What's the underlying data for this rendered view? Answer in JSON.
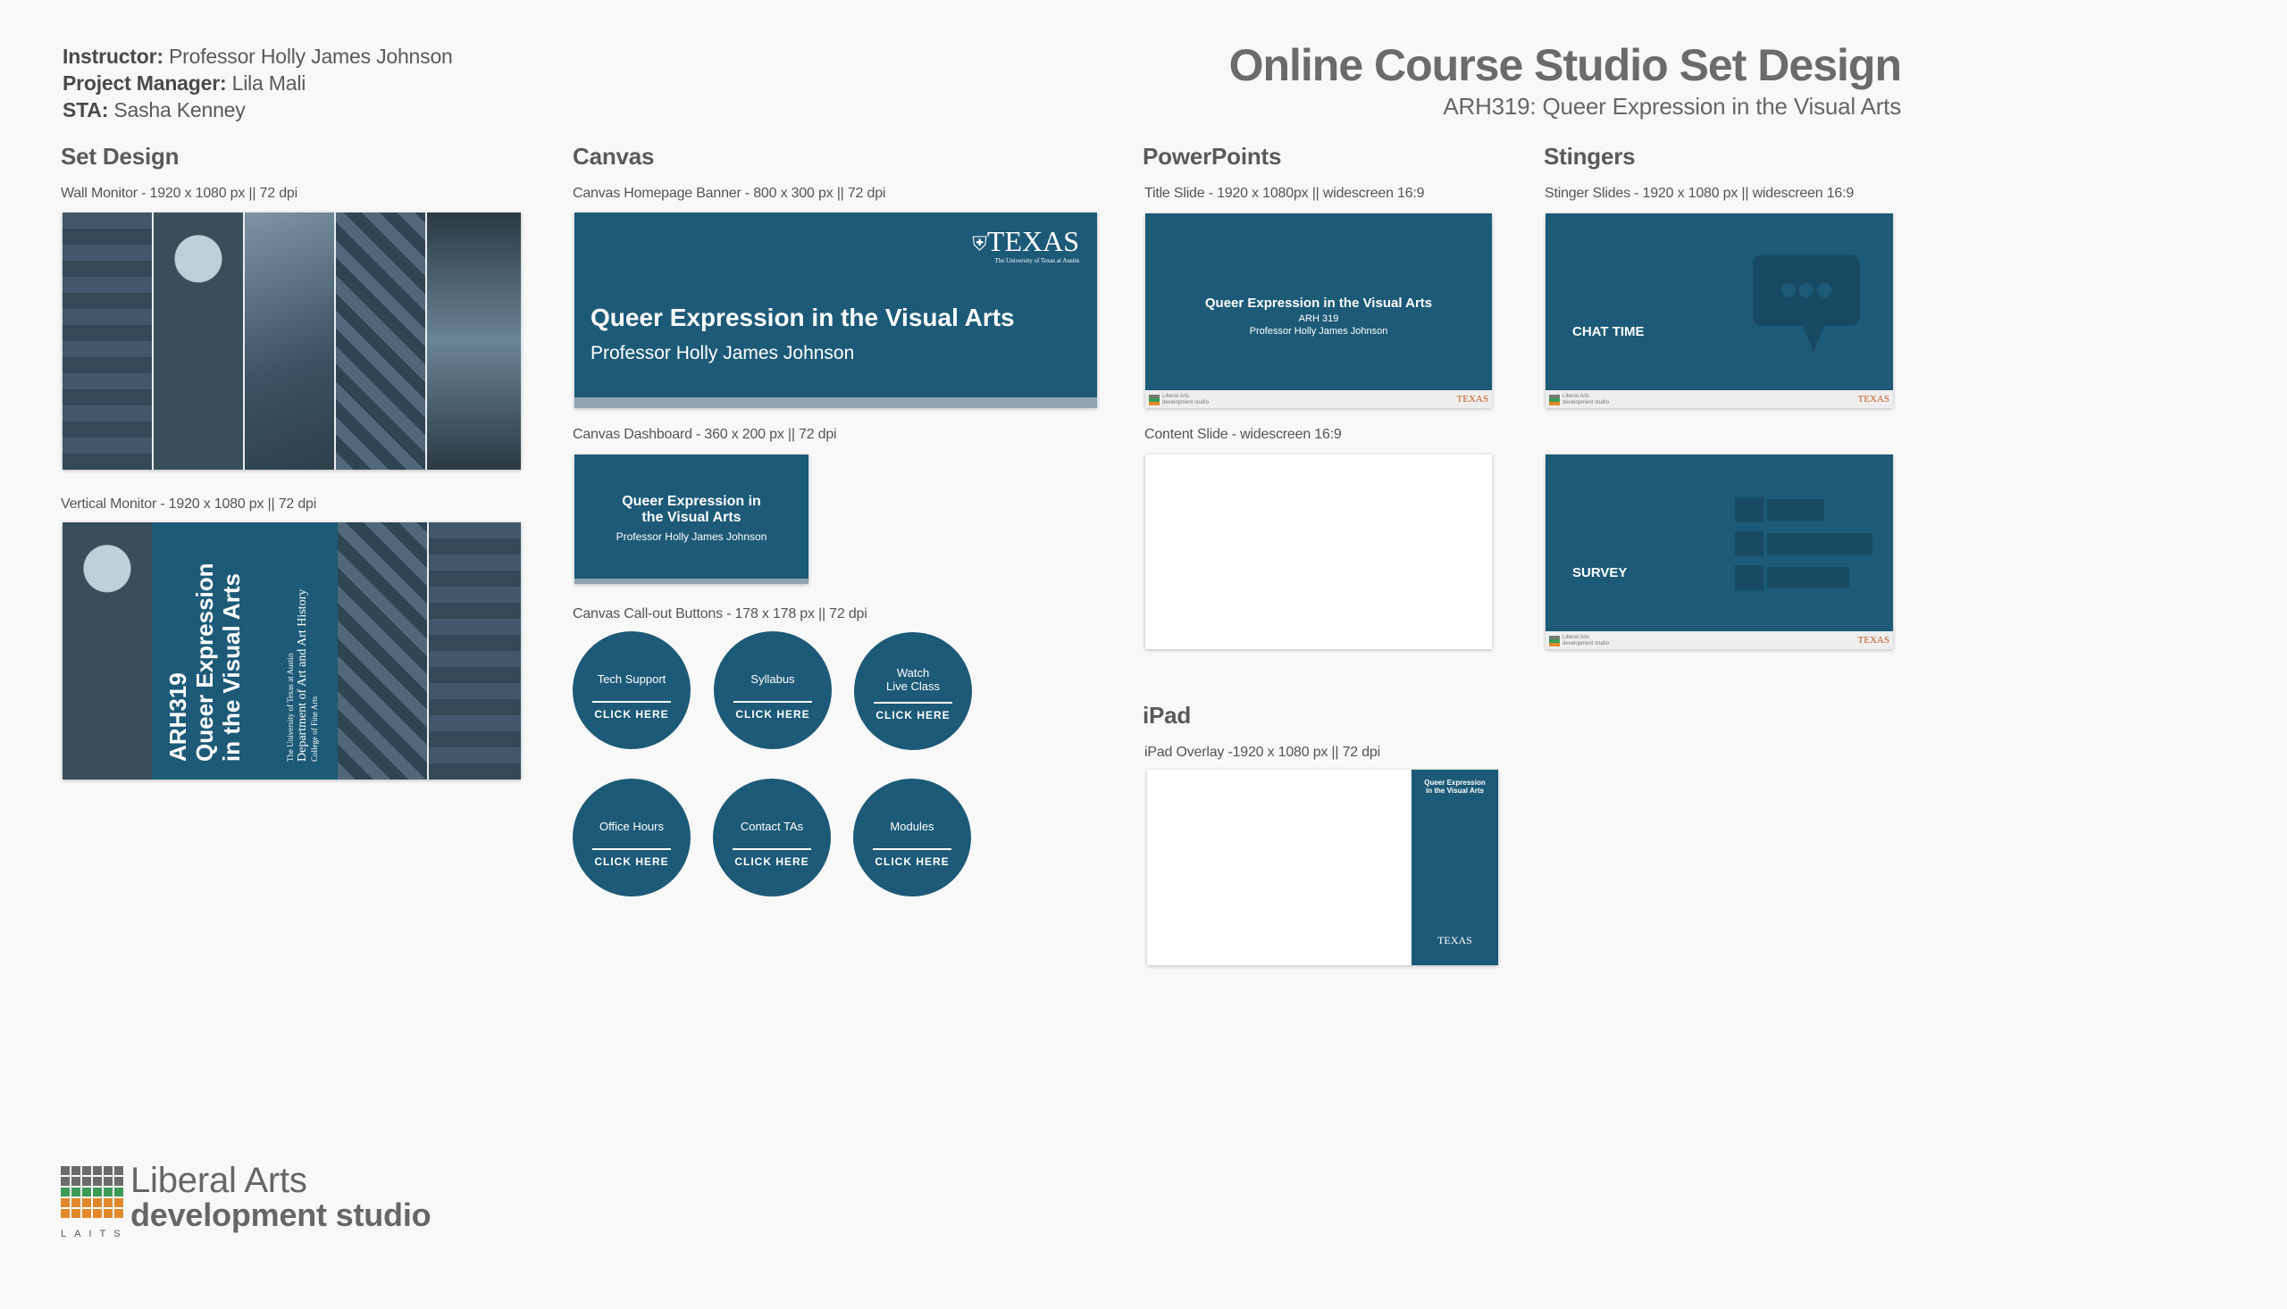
{
  "header": {
    "instructor_label": "Instructor:",
    "instructor": "Professor Holly James Johnson",
    "pm_label": "Project Manager:",
    "pm": "Lila Mali",
    "sta_label": "STA:",
    "sta": "Sasha Kenney",
    "title": "Online Course Studio Set Design",
    "subtitle": "ARH319: Queer Expression in the Visual Arts"
  },
  "set_design": {
    "heading": "Set Design",
    "wall_label": "Wall Monitor - 1920 x 1080 px || 72 dpi",
    "vertical_label": "Vertical Monitor - 1920 x 1080 px || 72 dpi",
    "vertical_code": "ARH319",
    "vertical_title_1": "Queer Expression",
    "vertical_title_2": "in the Visual Arts",
    "vertical_dept_small": "The University of Texas at Austin",
    "vertical_dept": "Department of Art and Art History",
    "vertical_college": "College of Fine Arts"
  },
  "canvas": {
    "heading": "Canvas",
    "banner_label": "Canvas Homepage Banner - 800 x 300 px || 72 dpi",
    "banner_texas": "TEXAS",
    "banner_texas_sub": "The University of Texas at Austin",
    "banner_title": "Queer Expression in the Visual Arts",
    "banner_prof": "Professor Holly James Johnson",
    "dash_label": "Canvas Dashboard - 360 x 200 px || 72 dpi",
    "dash_title_1": "Queer Expression in",
    "dash_title_2": "the Visual Arts",
    "dash_prof": "Professor Holly James Johnson",
    "buttons_label": "Canvas Call-out Buttons - 178 x 178 px || 72 dpi",
    "click_here": "CLICK HERE",
    "buttons": [
      {
        "line1": "Tech Support",
        "line2": ""
      },
      {
        "line1": "Syllabus",
        "line2": ""
      },
      {
        "line1": "Watch",
        "line2": "Live Class"
      },
      {
        "line1": "Office Hours",
        "line2": ""
      },
      {
        "line1": "Contact TAs",
        "line2": ""
      },
      {
        "line1": "Modules",
        "line2": ""
      }
    ]
  },
  "powerpoints": {
    "heading": "PowerPoints",
    "title_label": "Title Slide - 1920 x 1080px || widescreen 16:9",
    "title_slide_title": "Queer Expression in the Visual Arts",
    "title_slide_code": "ARH 319",
    "title_slide_prof": "Professor Holly James Johnson",
    "content_label": "Content Slide - widescreen 16:9",
    "footer_logo_line1": "Liberal Arts",
    "footer_logo_line2": "development studio",
    "footer_texas": "TEXAS"
  },
  "ipad": {
    "heading": "iPad",
    "label": "iPad Overlay -1920 x 1080 px || 72 dpi",
    "title_1": "Queer Expression",
    "title_2": "in the Visual Arts",
    "texas": "TEXAS"
  },
  "stingers": {
    "heading": "Stingers",
    "label": "Stinger Slides - 1920 x 1080 px || widescreen 16:9",
    "chat": "CHAT TIME",
    "survey": "SURVEY"
  },
  "logo": {
    "line1": "Liberal Arts",
    "line2": "development studio",
    "laits": "LAITS"
  },
  "colors": {
    "brand_blue": "#1c5a78",
    "texas_orange": "#c8571e",
    "background": "#f8f8f8"
  }
}
